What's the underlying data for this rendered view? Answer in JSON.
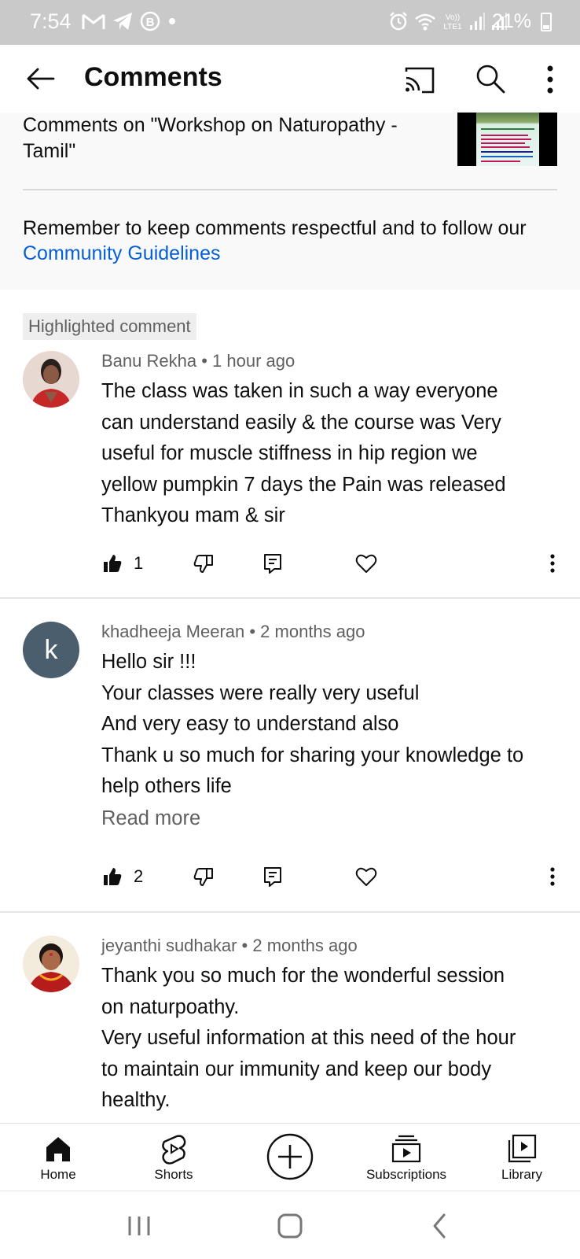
{
  "status_bar": {
    "time": "7:54",
    "battery": "21%",
    "left_icons": [
      "gmail-icon",
      "telegram-icon",
      "b-icon",
      "dot-icon"
    ],
    "right_icons": [
      "alarm-icon",
      "wifi-icon",
      "volte-icon",
      "signal-icon",
      "signal-icon"
    ]
  },
  "app_bar": {
    "title": "Comments",
    "icons": [
      "back-arrow-icon",
      "cast-icon",
      "search-icon",
      "more-vert-icon"
    ]
  },
  "header": {
    "video_title": "Comments on \"Workshop on Naturopathy - Tamil\"",
    "guidelines_prefix": "Remember to keep comments respectful and to follow our ",
    "guidelines_link": "Community Guidelines"
  },
  "highlight_label": "Highlighted comment",
  "comments": [
    {
      "author": "Banu Rekha",
      "time": "1 hour ago",
      "meta": "Banu Rekha • 1 hour ago",
      "text": "The class was taken in such a way everyone\ncan understand easily & the course was Very\nuseful  for muscle stiffness in hip region we\nyellow pumpkin 7 days the Pain was released\nThankyou mam & sir",
      "likes": "1",
      "avatar_letter": ""
    },
    {
      "author": "khadheeja Meeran",
      "time": "2 months ago",
      "meta": "khadheeja Meeran • 2 months ago",
      "text": "Hello sir !!!\nYour classes were really very useful\nAnd very easy to understand also\nThank u so much for sharing your knowledge to\nhelp others life",
      "read_more": "Read more",
      "likes": "2",
      "avatar_letter": "k"
    },
    {
      "author": "jeyanthi sudhakar",
      "time": "2 months ago",
      "meta": "jeyanthi sudhakar • 2 months ago",
      "text": "Thank you so much for the wonderful session\non naturpoathy.\nVery useful information at this need of the hour\nto maintain our immunity and keep our body\nhealthy.",
      "avatar_letter": ""
    }
  ],
  "bottom_nav": {
    "home": "Home",
    "shorts": "Shorts",
    "create": "",
    "subscriptions": "Subscriptions",
    "library": "Library"
  },
  "colors": {
    "link": "#065fd4",
    "status_bar_bg": "#c9c9c9",
    "header_bg": "#f9f9f9",
    "avatar_k_bg": "#4a5e6d"
  }
}
